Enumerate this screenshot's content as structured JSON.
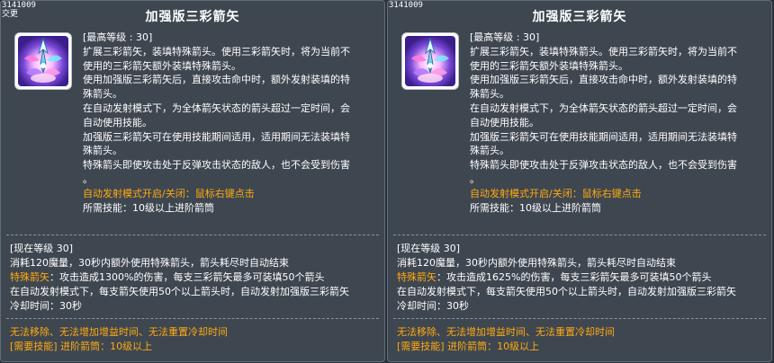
{
  "tooltips": [
    {
      "skill_id": "3141009",
      "tag": "交更",
      "title": "加强版三彩箭矢",
      "icon": "tri-color-arrow-skill-icon",
      "description": [
        "[最高等级 : 30]",
        "扩展三彩箭矢，装填特殊箭头。使用三彩箭矢时，将为当前不",
        "使用的三彩箭矢额外装填特殊箭头。",
        "使用加强版三彩箭矢后，直接攻击命中时，额外发射装填的特",
        "殊箭头。",
        "在自动发射模式下，为全体箭矢状态的箭头超过一定时间，会",
        "自动使用技能。",
        "加强版三彩箭矢可在使用技能期间适用，适用期间无法装填特",
        "殊箭头。",
        "特殊箭头即使攻击处于反弹攻击状态的敌人，也不会受到伤害",
        "。"
      ],
      "auto_fire": "自动发射模式开启/关闭：鼠标右键点击",
      "required_skill": "所需技能：10级以上进阶箭筒",
      "current_level": "[现在等级 30]",
      "current_lines": [
        "消耗120魔量，30秒内额外使用特殊箭头，箭头耗尽时自动结束"
      ],
      "special_arrow_label": "特殊箭矢",
      "special_arrow_text": "：攻击造成1300%的伤害，每支三彩箭矢最多可装填50个箭头",
      "current_lines_2": [
        "在自动发射模式下，每支箭矢使用50个以上箭头时，自动发射加强版三彩箭矢",
        "冷却时间：30秒"
      ],
      "footer": [
        "无法移除、无法增加增益时间、无法重置冷却时间",
        "[需要技能] 进阶箭筒：10级以上"
      ]
    },
    {
      "skill_id": "3141009",
      "tag": "",
      "title": "加强版三彩箭矢",
      "icon": "tri-color-arrow-skill-icon",
      "description": [
        "[最高等级 : 30]",
        "扩展三彩箭矢，装填特殊箭头。使用三彩箭矢时，将为当前不",
        "使用的三彩箭矢额外装填特殊箭头。",
        "使用加强版三彩箭矢后，直接攻击命中时，额外发射装填的特",
        "殊箭头。",
        "在自动发射模式下，为全体箭矢状态的箭头超过一定时间，会",
        "自动使用技能。",
        "加强版三彩箭矢可在使用技能期间适用，适用期间无法装填特",
        "殊箭头。",
        "特殊箭头即使攻击处于反弹攻击状态的敌人，也不会受到伤害",
        "。"
      ],
      "auto_fire": "自动发射模式开启/关闭：鼠标右键点击",
      "required_skill": "所需技能：10级以上进阶箭筒",
      "current_level": "[现在等级 30]",
      "current_lines": [
        "消耗120魔量，30秒内额外使用特殊箭头，箭头耗尽时自动结束"
      ],
      "special_arrow_label": "特殊箭矢",
      "special_arrow_text": "：攻击造成1625%的伤害，每支三彩箭矢最多可装填50个箭头",
      "current_lines_2": [
        "在自动发射模式下，每支箭矢使用50个以上箭头时，自动发射加强版三彩箭矢",
        "冷却时间：30秒"
      ],
      "footer": [
        "无法移除、无法增加增益时间、无法重置冷却时间",
        "[需要技能] 进阶箭筒：10级以上"
      ]
    }
  ]
}
